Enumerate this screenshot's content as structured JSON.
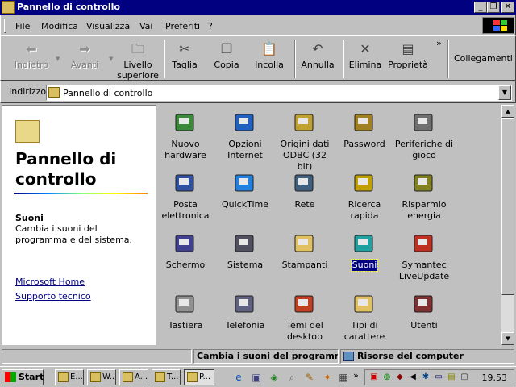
{
  "window": {
    "title": "Pannello di controllo",
    "minimize": "_",
    "maximize": "❐",
    "close": "✕"
  },
  "menu": [
    "File",
    "Modifica",
    "Visualizza",
    "Vai",
    "Preferiti",
    "?"
  ],
  "toolbar": {
    "back": "Indietro",
    "forward": "Avanti",
    "up": "Livello superiore",
    "cut": "Taglia",
    "copy": "Copia",
    "paste": "Incolla",
    "undo": "Annulla",
    "delete": "Elimina",
    "properties": "Proprietà",
    "more": "»",
    "links": "Collegamenti"
  },
  "address": {
    "label": "Indirizzo",
    "value": "Pannello di controllo"
  },
  "left_pane": {
    "title": "Pannello di controllo",
    "selected_heading": "Suoni",
    "selected_desc": "Cambia i suoni del programma e del sistema.",
    "links": [
      "Microsoft Home",
      "Supporto tecnico"
    ]
  },
  "icons": [
    {
      "label": "Nuovo hardware",
      "icon": "new-hardware-icon"
    },
    {
      "label": "Opzioni Internet",
      "icon": "internet-options-icon"
    },
    {
      "label": "Origini dati ODBC (32 bit)",
      "icon": "odbc-icon"
    },
    {
      "label": "Password",
      "icon": "keys-icon"
    },
    {
      "label": "Periferiche di gioco",
      "icon": "joystick-icon"
    },
    {
      "label": "Posta elettronica",
      "icon": "mail-icon"
    },
    {
      "label": "QuickTime",
      "icon": "quicktime-icon"
    },
    {
      "label": "Rete",
      "icon": "network-icon"
    },
    {
      "label": "Ricerca rapida",
      "icon": "binoculars-icon"
    },
    {
      "label": "Risparmio energia",
      "icon": "power-plug-icon"
    },
    {
      "label": "Schermo",
      "icon": "display-icon"
    },
    {
      "label": "Sistema",
      "icon": "computer-icon"
    },
    {
      "label": "Stampanti",
      "icon": "printers-folder-icon"
    },
    {
      "label": "Suoni",
      "icon": "speaker-icon",
      "selected": true
    },
    {
      "label": "Symantec LiveUpdate",
      "icon": "liveupdate-icon"
    },
    {
      "label": "Tastiera",
      "icon": "keyboard-icon"
    },
    {
      "label": "Telefonia",
      "icon": "telephony-icon"
    },
    {
      "label": "Temi del desktop",
      "icon": "themes-icon"
    },
    {
      "label": "Tipi di carattere",
      "icon": "fonts-folder-icon"
    },
    {
      "label": "Utenti",
      "icon": "users-icon"
    }
  ],
  "status": {
    "description": "Cambia i suoni del programma e",
    "location": "Risorse del computer"
  },
  "taskbar": {
    "start": "Start",
    "buttons": [
      "E...",
      "W...",
      "A...",
      "T...",
      "P..."
    ],
    "more": "»",
    "clock": "19.53"
  },
  "colors": {
    "titlebar": "#000080",
    "face": "#c0c0c0",
    "selection": "#000080"
  }
}
